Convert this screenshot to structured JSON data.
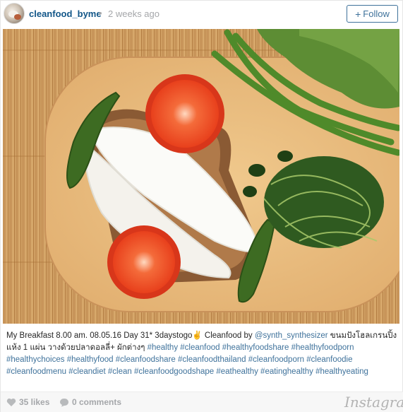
{
  "post": {
    "username": "cleanfood_byme",
    "separator": "•",
    "time_ago": "2 weeks ago",
    "follow_label": "Follow",
    "follow_plus": "+"
  },
  "caption": {
    "text_1": "My Breakfast 8.00 am. 08.05.16 Day 31* 3daystogo✌ Cleanfood by ",
    "mention": "@synth_synthesizer",
    "text_2": " ขนมปังโฮลเกรนปิ้งแห้ง 1 แผ่น วางด้วยปลาดอลลี่+ ผักต่างๆ ",
    "hashtags": [
      "#healthy",
      "#cleanfood",
      "#healthyfoodshare",
      "#healthyfoodporn",
      "#healthychoices",
      "#healthyfood",
      "#cleanfoodshare",
      "#cleanfoodthailand",
      "#cleanfoodporn",
      "#cleanfoodie",
      "#cleanfoodmenu",
      "#cleandiet",
      "#clean",
      "#cleanfoodgoodshape",
      "#eathealthy",
      "#eatinghealthy",
      "#healthyeating"
    ]
  },
  "footer": {
    "likes": "35 likes",
    "comments": "0 comments",
    "brand": "Instagram"
  },
  "icons": {
    "like": "heart-icon",
    "comment": "speech-bubble-icon"
  },
  "colors": {
    "link": "#3f729b",
    "username": "#125688",
    "muted": "#a5a7aa"
  }
}
